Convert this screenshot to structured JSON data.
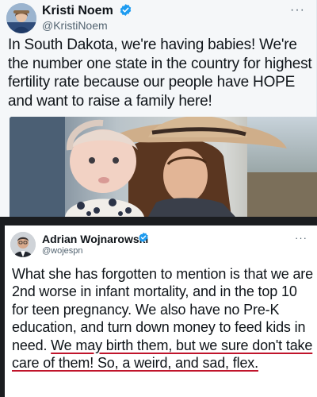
{
  "tweet_1": {
    "display_name": "Kristi Noem",
    "handle": "@KristiNoem",
    "verified": true,
    "more_label": "···",
    "text": "In South Dakota, we're having babies! We're the number one state in the country for highest fertility rate because our people have HOPE and want to raise a family here!",
    "media": "photo of a woman in a cowboy hat holding a baby",
    "colors": {
      "background": "#f5f7f9",
      "verified": "#1d9bf0"
    }
  },
  "tweet_2": {
    "display_name": "Adrian Wojnarowski",
    "handle": "@wojespn",
    "verified": true,
    "more_label": "···",
    "text_plain": "What she has forgotten to mention is that we are 2nd worse in infant mortality, and in the top 10 for teen pregnancy. We also have no Pre-K education, and turn down money to feed kids in need. ",
    "text_underlined": "We may birth them, but we sure don't take care of them! So, a weird, and sad, flex.",
    "colors": {
      "underline": "#c0142b",
      "background": "#ffffff"
    }
  },
  "icons": {
    "verified": "verified-badge-icon",
    "more": "more-options-icon"
  }
}
